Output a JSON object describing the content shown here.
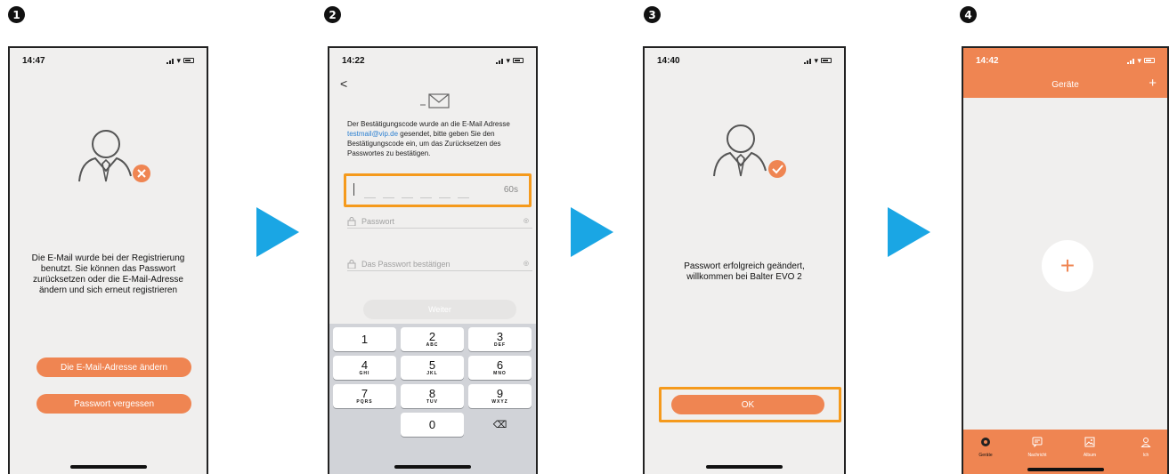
{
  "steps": [
    "1",
    "2",
    "3",
    "4"
  ],
  "accent": "#ef8552",
  "highlight": "#f59a1c",
  "arrow_color": "#1aa6e4",
  "screen1": {
    "time": "14:47",
    "message_lines": [
      "Die E-Mail wurde bei der Registrierung",
      "benutzt. Sie können das Passwort",
      "zurücksetzen oder die E-Mail-Adresse",
      "ändern und sich erneut registrieren"
    ],
    "change_email_button": "Die E-Mail-Adresse ändern",
    "forgot_password_button": "Passwort vergessen"
  },
  "screen2": {
    "time": "14:22",
    "back": "<",
    "verify_text_before": "Der Bestätigungscode wurde an die E-Mail Adresse ",
    "verify_email": "testmail@vip.de",
    "verify_text_after": " gesendet, bitte geben Sie den Bestätigungscode ein, um das Zurücksetzen des Passwortes zu bestätigen.",
    "timer": "60s",
    "password_placeholder": "Passwort",
    "confirm_placeholder": "Das Passwort bestätigen",
    "next_button": "Weiter",
    "keys": [
      {
        "d": "1",
        "l": ""
      },
      {
        "d": "2",
        "l": "ABC"
      },
      {
        "d": "3",
        "l": "DEF"
      },
      {
        "d": "4",
        "l": "GHI"
      },
      {
        "d": "5",
        "l": "JKL"
      },
      {
        "d": "6",
        "l": "MNO"
      },
      {
        "d": "7",
        "l": "PQRS"
      },
      {
        "d": "8",
        "l": "TUV"
      },
      {
        "d": "9",
        "l": "WXYZ"
      },
      {
        "d": "0",
        "l": ""
      }
    ],
    "delete_key": "⌫"
  },
  "screen3": {
    "time": "14:40",
    "message_lines": [
      "Passwort erfolgreich geändert,",
      "willkommen bei Balter EVO 2"
    ],
    "ok_button": "OK"
  },
  "screen4": {
    "time": "14:42",
    "title": "Geräte",
    "header_add": "+",
    "add_device": "+",
    "tabs": [
      "Geräte",
      "Nachricht",
      "Album",
      "Ich"
    ]
  }
}
